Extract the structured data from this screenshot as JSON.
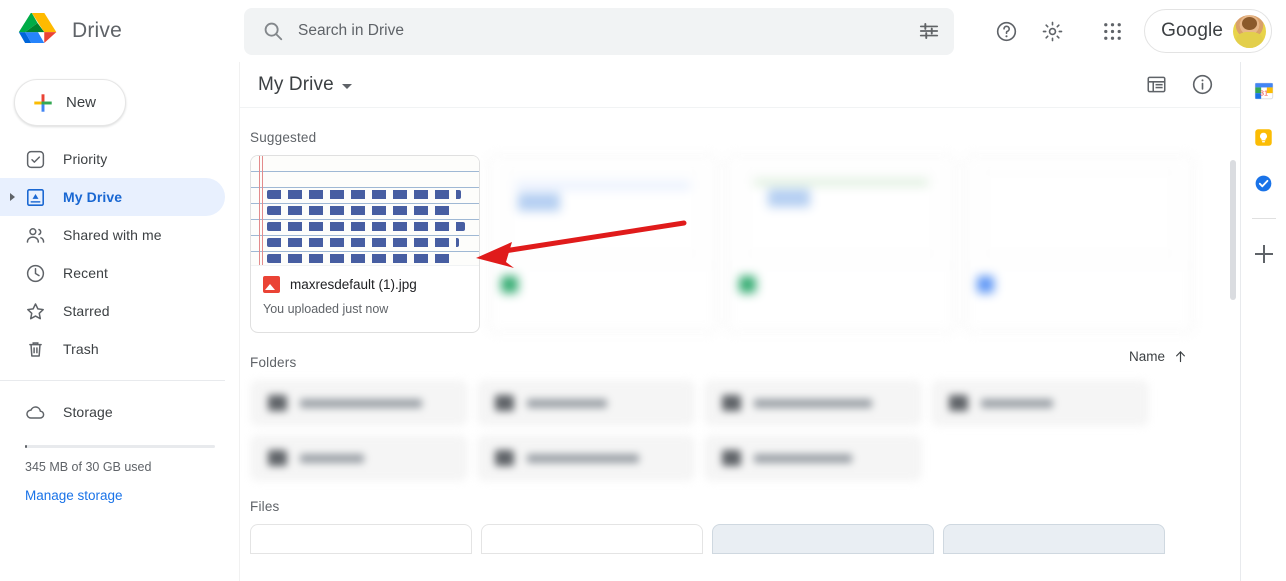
{
  "app": {
    "brand_name": "Drive",
    "logo_icon": "google-drive-logo"
  },
  "search": {
    "placeholder": "Search in Drive",
    "value": "",
    "search_icon": "search-icon",
    "options_icon": "tune-options-icon"
  },
  "topbar_right": {
    "help_icon": "help-circle-icon",
    "settings_icon": "gear-icon",
    "apps_icon": "apps-grid-icon",
    "account_label": "Google",
    "avatar_icon": "user-avatar"
  },
  "sidebar": {
    "new_button": {
      "label": "New",
      "icon": "plus-colored-icon"
    },
    "items": [
      {
        "label": "Priority",
        "icon": "check-circle-icon",
        "active": false,
        "expandable": false
      },
      {
        "label": "My Drive",
        "icon": "my-drive-icon",
        "active": true,
        "expandable": true
      },
      {
        "label": "Shared with me",
        "icon": "people-icon",
        "active": false,
        "expandable": false
      },
      {
        "label": "Recent",
        "icon": "clock-icon",
        "active": false,
        "expandable": false
      },
      {
        "label": "Starred",
        "icon": "star-icon",
        "active": false,
        "expandable": false
      },
      {
        "label": "Trash",
        "icon": "trash-icon",
        "active": false,
        "expandable": false
      }
    ],
    "storage_item": {
      "label": "Storage",
      "icon": "cloud-icon"
    },
    "storage_used_text": "345 MB of 30 GB used",
    "storage_percent": 1.15,
    "manage_storage_label": "Manage storage"
  },
  "main": {
    "breadcrumb": "My Drive",
    "breadcrumb_caret_icon": "chevron-down-icon",
    "list_view_icon": "list-view-icon",
    "info_icon": "info-circle-icon",
    "suggested_title": "Suggested",
    "folders_title": "Folders",
    "files_title": "Files",
    "sort_label": "Name",
    "sort_direction_icon": "arrow-up-icon",
    "suggested": [
      {
        "name": "maxresdefault (1).jpg",
        "meta": "You uploaded just now",
        "type_icon": "image-file-icon",
        "blurred": false,
        "thumb": "handwritten-note"
      },
      {
        "name": "",
        "meta": "",
        "type_icon": "sheets-file-icon",
        "blurred": true,
        "thumb": "spreadsheet"
      },
      {
        "name": "",
        "meta": "",
        "type_icon": "sheets-file-icon",
        "blurred": true,
        "thumb": "spreadsheet"
      },
      {
        "name": "",
        "meta": "",
        "type_icon": "docs-file-icon",
        "blurred": true,
        "thumb": "document"
      }
    ],
    "folders": [
      {
        "name": "",
        "icon": "folder-icon"
      },
      {
        "name": "",
        "icon": "folder-icon"
      },
      {
        "name": "",
        "icon": "folder-icon"
      },
      {
        "name": "",
        "icon": "folder-icon"
      },
      {
        "name": "",
        "icon": "folder-icon"
      },
      {
        "name": "",
        "icon": "folder-icon"
      },
      {
        "name": "",
        "icon": "folder-icon"
      }
    ]
  },
  "rail": {
    "items": [
      {
        "name": "google-calendar-icon",
        "label": "31"
      },
      {
        "name": "google-keep-icon",
        "label": ""
      },
      {
        "name": "google-tasks-icon",
        "label": ""
      }
    ],
    "add_label": "+",
    "add_icon": "plus-icon"
  },
  "annotation": {
    "arrow_color": "#e01b1b",
    "arrow_icon": "red-arrow-pointing-left"
  },
  "colors": {
    "accent_blue": "#1a73e8",
    "active_pill": "#e8f0fe",
    "drive_green": "#0f9d58",
    "drive_yellow": "#ffc107",
    "drive_blue": "#4285f4",
    "red": "#ea4335"
  }
}
